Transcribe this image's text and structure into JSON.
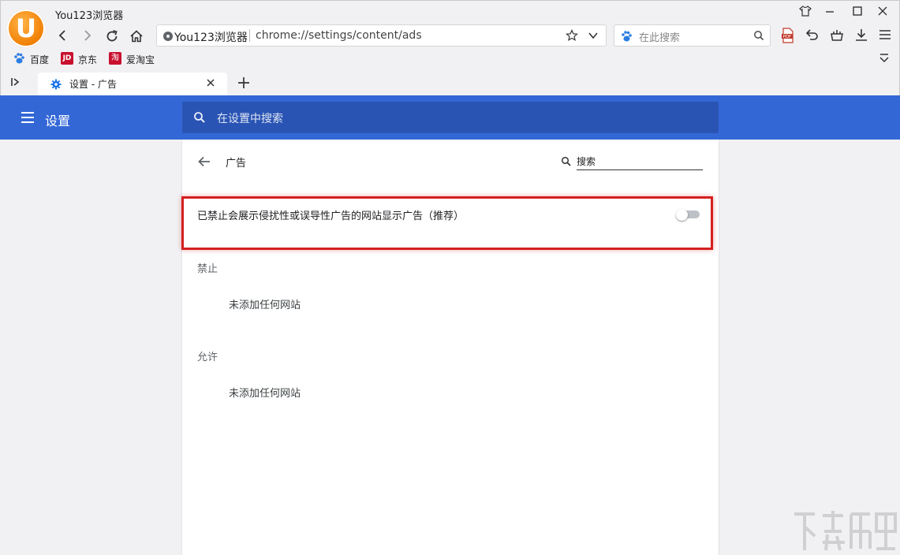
{
  "app": {
    "title": "You123浏览器"
  },
  "address_bar": {
    "site_name": "You123浏览器",
    "url": "chrome://settings/content/ads"
  },
  "search_bar": {
    "placeholder": "在此搜索"
  },
  "bookmarks": [
    {
      "label": "百度",
      "icon": "baidu-paw-icon"
    },
    {
      "label": "京东",
      "icon": "jd-icon"
    },
    {
      "label": "爱淘宝",
      "icon": "taobao-icon"
    }
  ],
  "tab": {
    "title": "设置 - 广告"
  },
  "settings": {
    "header_title": "设置",
    "search_placeholder": "在设置中搜索"
  },
  "ads_page": {
    "title": "广告",
    "search_placeholder": "搜索",
    "toggle_label": "已禁止会展示侵扰性或误导性广告的网站显示广告（推荐）",
    "toggle_on": false,
    "blocked_heading": "禁止",
    "blocked_empty": "未添加任何网站",
    "allowed_heading": "允许",
    "allowed_empty": "未添加任何网站"
  },
  "colors": {
    "settings_blue": "#3367d6",
    "highlight_red": "#d42020",
    "logo_orange": "#f07d00"
  }
}
